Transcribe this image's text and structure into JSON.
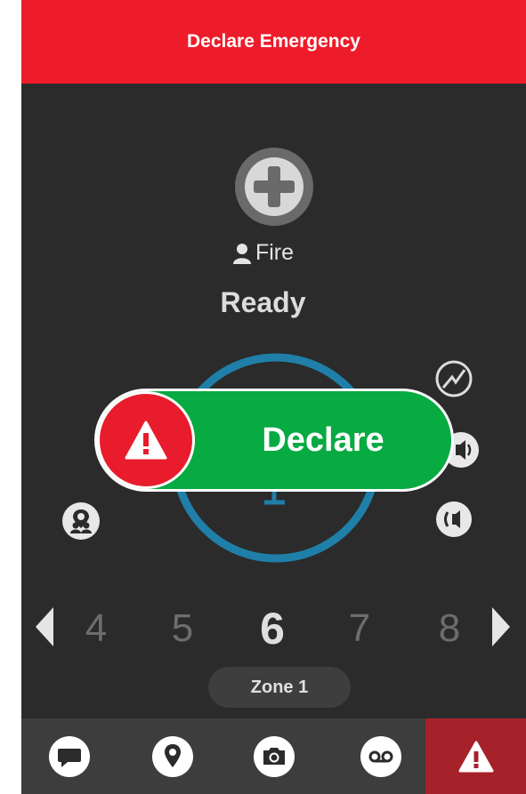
{
  "header": {
    "title": "Declare Emergency"
  },
  "channel": {
    "icon": "plus-circle-icon"
  },
  "role": {
    "icon": "person-icon",
    "label": "Fire"
  },
  "status": {
    "label": "Ready"
  },
  "declare": {
    "label": "Declare",
    "knob_icon": "warning-triangle-icon",
    "color": "#08aa42",
    "knob_color": "#e81c2c"
  },
  "side_icons": {
    "left": [
      {
        "name": "team-location-icon"
      }
    ],
    "right": [
      {
        "name": "signal-graph-icon"
      },
      {
        "name": "speaker-icon"
      },
      {
        "name": "ear-speaker-icon"
      }
    ]
  },
  "zones": {
    "numbers": [
      "4",
      "5",
      "6",
      "7",
      "8"
    ],
    "active": "6",
    "label": "Zone 1"
  },
  "bottom_tabs": [
    {
      "name": "messages-icon"
    },
    {
      "name": "location-pin-icon"
    },
    {
      "name": "camera-icon"
    },
    {
      "name": "voicemail-icon"
    },
    {
      "name": "emergency-icon"
    }
  ],
  "colors": {
    "header": "#ee1c2a",
    "ring": "#1f7fa8",
    "alert_tab": "#a5222b"
  }
}
